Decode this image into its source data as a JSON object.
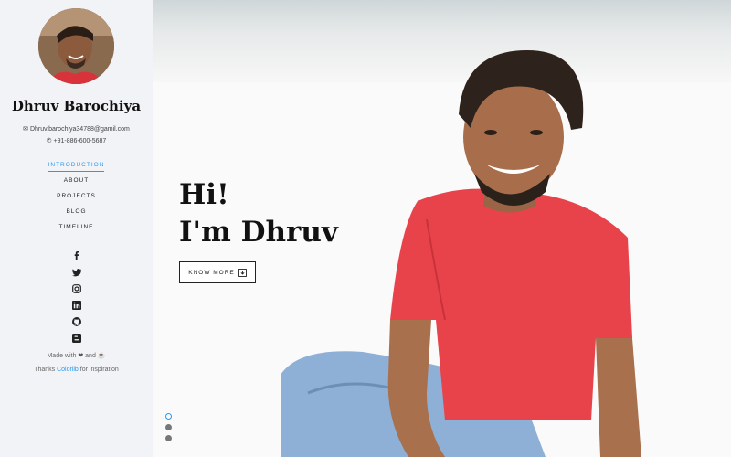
{
  "profile": {
    "name": "Dhruv Barochiya",
    "email": "Dhruv.barochiya34788@gamil.com",
    "phone": "+91-886-600-5687"
  },
  "nav": {
    "items": [
      {
        "label": "INTRODUCTION",
        "active": true
      },
      {
        "label": "ABOUT"
      },
      {
        "label": "PROJECTS"
      },
      {
        "label": "BLOG"
      },
      {
        "label": "TIMELINE"
      }
    ]
  },
  "social": [
    "facebook-icon",
    "twitter-icon",
    "instagram-icon",
    "linkedin-icon",
    "github-icon",
    "blogger-icon"
  ],
  "footer": {
    "made_with": "Made with",
    "and": "and",
    "thanks": "Thanks",
    "link": "Colorlib",
    "inspiration": "for inspiration"
  },
  "hero": {
    "line1": "Hi!",
    "line2": "I'm Dhruv",
    "button": "KNOW MORE"
  },
  "slides": {
    "count": 3,
    "active": 0
  },
  "colors": {
    "accent": "#2c98f0",
    "sidebar_bg": "#f2f3f7",
    "shirt": "#e8434b"
  }
}
